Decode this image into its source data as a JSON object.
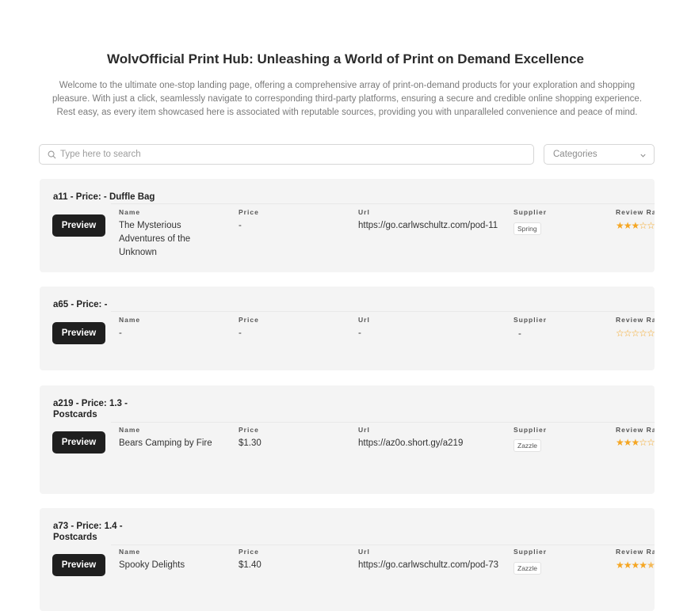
{
  "header": {
    "title": "WolvOfficial Print Hub: Unleashing a World of Print on Demand Excellence",
    "intro_line1": "Welcome to the ultimate one-stop landing page, offering a comprehensive array of print-on-demand products for your exploration and shopping",
    "intro_line2": "pleasure. With just a click, seamlessly navigate to corresponding third-party platforms, ensuring a secure and credible online shopping experience.",
    "intro_line3": "Rest easy, as every item showcased here is associated with reputable sources, providing you with unparalleled convenience and peace of mind."
  },
  "search": {
    "placeholder": "Type here to search",
    "value": ""
  },
  "categories": {
    "label": "Categories"
  },
  "columns": {
    "name": "Name",
    "price": "Price",
    "url": "Url",
    "supplier": "Supplier",
    "review": "Review Ra"
  },
  "preview_label": "Preview",
  "colors": {
    "accent": "#1f1f1f",
    "star": "#f5a623",
    "card_bg": "#f4f4f4"
  },
  "products": [
    {
      "title_line1": "a11 - Price: - Duffle Bag",
      "title_line2": "",
      "name": "The Mysterious Adventures of the Unknown",
      "price": "-",
      "url": "https://go.carlwschultz.com/pod-11",
      "supplier": "Spring",
      "rating": 3
    },
    {
      "title_line1": "a65 - Price: -",
      "title_line2": "",
      "name": "-",
      "price": "-",
      "url": "-",
      "supplier": "-",
      "rating": 0
    },
    {
      "title_line1": "a219 - Price: 1.3 -",
      "title_line2": "Postcards",
      "name": "Bears Camping by Fire",
      "price": "$1.30",
      "url": "https://az0o.short.gy/a219",
      "supplier": "Zazzle",
      "rating": 3
    },
    {
      "title_line1": "a73 - Price: 1.4 -",
      "title_line2": "Postcards",
      "name": "Spooky Delights",
      "price": "$1.40",
      "url": "https://go.carlwschultz.com/pod-73",
      "supplier": "Zazzle",
      "rating": 4.5
    }
  ]
}
